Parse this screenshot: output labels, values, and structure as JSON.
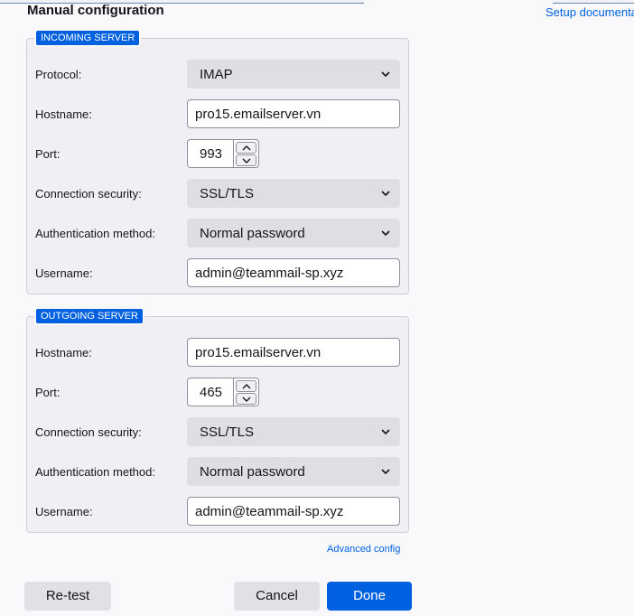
{
  "header": {
    "title": "Manual configuration",
    "setup_link": "Setup documentation"
  },
  "incoming": {
    "legend": "INCOMING SERVER",
    "protocol_label": "Protocol:",
    "protocol_value": "IMAP",
    "hostname_label": "Hostname:",
    "hostname_value": "pro15.emailserver.vn",
    "port_label": "Port:",
    "port_value": "993",
    "security_label": "Connection security:",
    "security_value": "SSL/TLS",
    "auth_label": "Authentication method:",
    "auth_value": "Normal password",
    "username_label": "Username:",
    "username_value": "admin@teammail-sp.xyz"
  },
  "outgoing": {
    "legend": "OUTGOING SERVER",
    "hostname_label": "Hostname:",
    "hostname_value": "pro15.emailserver.vn",
    "port_label": "Port:",
    "port_value": "465",
    "security_label": "Connection security:",
    "security_value": "SSL/TLS",
    "auth_label": "Authentication method:",
    "auth_value": "Normal password",
    "username_label": "Username:",
    "username_value": "admin@teammail-sp.xyz"
  },
  "advanced_link": "Advanced config",
  "buttons": {
    "retest": "Re-test",
    "cancel": "Cancel",
    "done": "Done"
  },
  "colors": {
    "accent": "#0061e0",
    "panel": "#f0f0f4",
    "select_bg": "#dedee3"
  },
  "icons": {
    "dropdown": "chevron-down-icon",
    "spin_up": "chevron-up-icon",
    "spin_down": "chevron-down-icon"
  }
}
